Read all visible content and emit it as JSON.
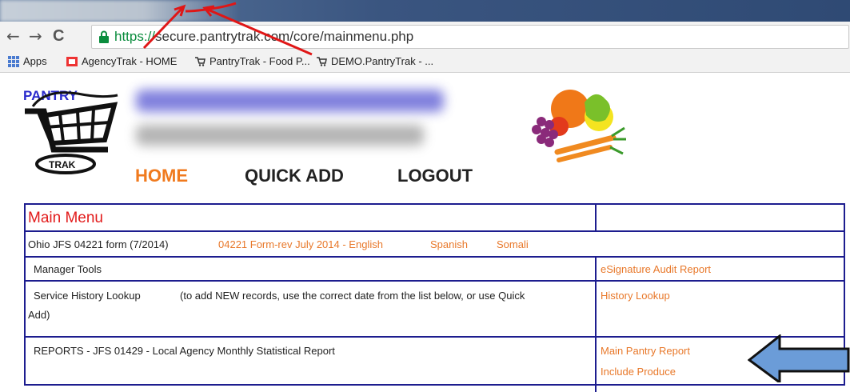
{
  "browser": {
    "url_scheme": "https://",
    "url_rest": "secure.pantrytrak.com/core/mainmenu.php",
    "nav": {
      "back": "←",
      "forward": "→",
      "reload": "C"
    },
    "bookmarks": [
      {
        "label": "Apps"
      },
      {
        "label": "AgencyTrak - HOME"
      },
      {
        "label": "PantryTrak - Food P..."
      },
      {
        "label": "DEMO.PantryTrak - ..."
      }
    ]
  },
  "header": {
    "logo_top": "PANTRY",
    "logo_bottom": "TRAK",
    "nav": {
      "home": "HOME",
      "quick_add": "QUICK ADD",
      "logout": "LOGOUT"
    }
  },
  "main_menu": {
    "title": "Main Menu",
    "jfs_row": {
      "label": "Ohio JFS 04221 form (7/2014)",
      "links": [
        "04221 Form-rev July 2014 - English",
        "Spanish",
        "Somali"
      ]
    },
    "manager_row": {
      "label": "Manager Tools",
      "link": "eSignature Audit Report"
    },
    "history_row": {
      "label_a": "Service History Lookup",
      "label_b": "(to add NEW records, use the correct date from the list below, or use Quick",
      "label_c": "Add)",
      "link": "History Lookup"
    },
    "reports_row": {
      "label": "REPORTS - JFS 01429 - Local Agency Monthly Statistical Report",
      "links": [
        "Main Pantry Report",
        "Include Produce"
      ]
    }
  },
  "colors": {
    "accent_orange": "#f07a1e",
    "link_orange": "#e8782a",
    "title_red": "#e21b1b",
    "table_border": "#1d1d8f",
    "annotation_arrow": "#6b9cd8"
  }
}
